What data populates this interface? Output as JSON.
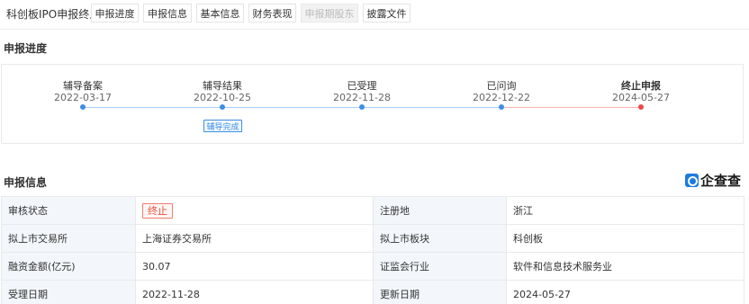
{
  "header": {
    "title": "科创板IPO申报终止",
    "tabs": [
      {
        "label": "申报进度",
        "disabled": false
      },
      {
        "label": "申报信息",
        "disabled": false
      },
      {
        "label": "基本信息",
        "disabled": false
      },
      {
        "label": "财务表现",
        "disabled": false
      },
      {
        "label": "申报期股东",
        "disabled": true
      },
      {
        "label": "披露文件",
        "disabled": false
      }
    ]
  },
  "progress": {
    "section_title": "申报进度",
    "steps": [
      {
        "name": "辅导备案",
        "date": "2022-03-17"
      },
      {
        "name": "辅导结果",
        "date": "2022-10-25",
        "badge": "辅导完成"
      },
      {
        "name": "已受理",
        "date": "2022-11-28"
      },
      {
        "name": "已问询",
        "date": "2022-12-22"
      },
      {
        "name": "终止申报",
        "date": "2024-05-27"
      }
    ],
    "colors": {
      "active": "#3c8ee6",
      "terminated": "#f04848",
      "line_active": "#a9cdf4",
      "line_terminated": "#f7b3ab"
    }
  },
  "info": {
    "section_title": "申报信息",
    "logo_text": "企查查",
    "rows": [
      [
        {
          "label": "审核状态",
          "value": "终止",
          "tag": true
        },
        {
          "label": "注册地",
          "value": "浙江"
        }
      ],
      [
        {
          "label": "拟上市交易所",
          "value": "上海证券交易所"
        },
        {
          "label": "拟上市板块",
          "value": "科创板"
        }
      ],
      [
        {
          "label": "融资金额(亿元)",
          "value": "30.07"
        },
        {
          "label": "证监会行业",
          "value": "软件和信息技术服务业"
        }
      ],
      [
        {
          "label": "受理日期",
          "value": "2022-11-28"
        },
        {
          "label": "更新日期",
          "value": "2024-05-27"
        }
      ]
    ]
  }
}
